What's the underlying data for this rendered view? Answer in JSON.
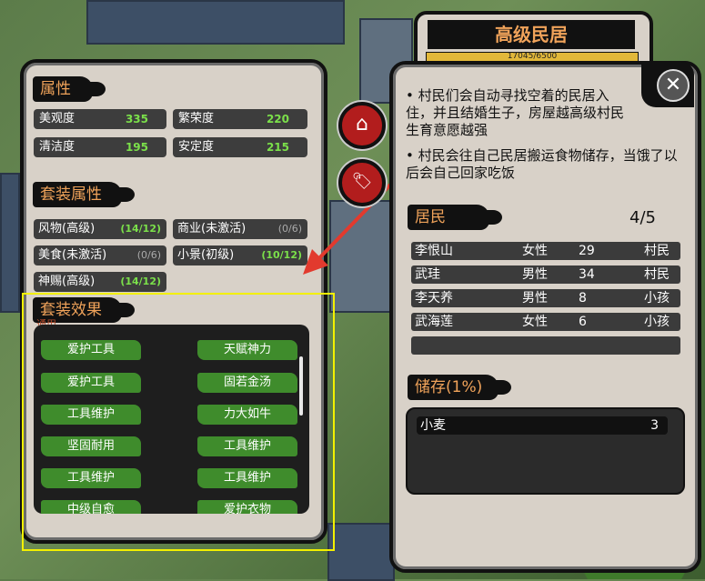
{
  "building": {
    "title": "高级民居",
    "progress_text": "17045/6500",
    "progress_fraction": 1.0,
    "desc": [
      "村民们会自动寻找空着的民居入住，并且结婚生子，房屋越高级村民生育意愿越强",
      "村民会往自己民居搬运食物储存，当饿了以后会自己回家吃饭"
    ]
  },
  "attributes": {
    "title": "属性",
    "items": [
      {
        "name": "美观度",
        "value": "335"
      },
      {
        "name": "繁荣度",
        "value": "220"
      },
      {
        "name": "清洁度",
        "value": "195"
      },
      {
        "name": "安定度",
        "value": "215"
      }
    ]
  },
  "set_attributes": {
    "title": "套装属性",
    "items": [
      {
        "name": "风物(高级)",
        "value": "(14/12)",
        "active": true
      },
      {
        "name": "商业(未激活)",
        "value": "(0/6)",
        "active": false
      },
      {
        "name": "美食(未激活)",
        "value": "(0/6)",
        "active": false
      },
      {
        "name": "小景(初级)",
        "value": "(10/12)",
        "active": true
      },
      {
        "name": "神赐(高级)",
        "value": "(14/12)",
        "active": true
      }
    ]
  },
  "set_effects": {
    "title": "套装效果",
    "partial_label": "通用",
    "items": [
      "爱护工具",
      "天赋神力",
      "爱护工具",
      "固若金汤",
      "工具维护",
      "力大如牛",
      "坚固耐用",
      "工具维护",
      "工具维护",
      "工具维护",
      "中级自愈",
      "爱护衣物"
    ]
  },
  "residents": {
    "title": "居民",
    "count": "4/5",
    "rows": [
      {
        "name": "李恨山",
        "gender": "女性",
        "age": "29",
        "role": "村民"
      },
      {
        "name": "武珪",
        "gender": "男性",
        "age": "34",
        "role": "村民"
      },
      {
        "name": "李天养",
        "gender": "男性",
        "age": "8",
        "role": "小孩"
      },
      {
        "name": "武海莲",
        "gender": "女性",
        "age": "6",
        "role": "小孩"
      }
    ]
  },
  "storage": {
    "title": "储存(1%)",
    "items": [
      {
        "name": "小麦",
        "qty": "3"
      }
    ]
  },
  "buttons": {
    "close": "✕",
    "home": "⌂",
    "tag": "🏷"
  },
  "colors": {
    "accent": "#f0a35a",
    "active_value": "#7be04a",
    "effect_green": "#3f8c2c",
    "highlight_box": "#f3f000",
    "arrow": "#e23a2e"
  }
}
